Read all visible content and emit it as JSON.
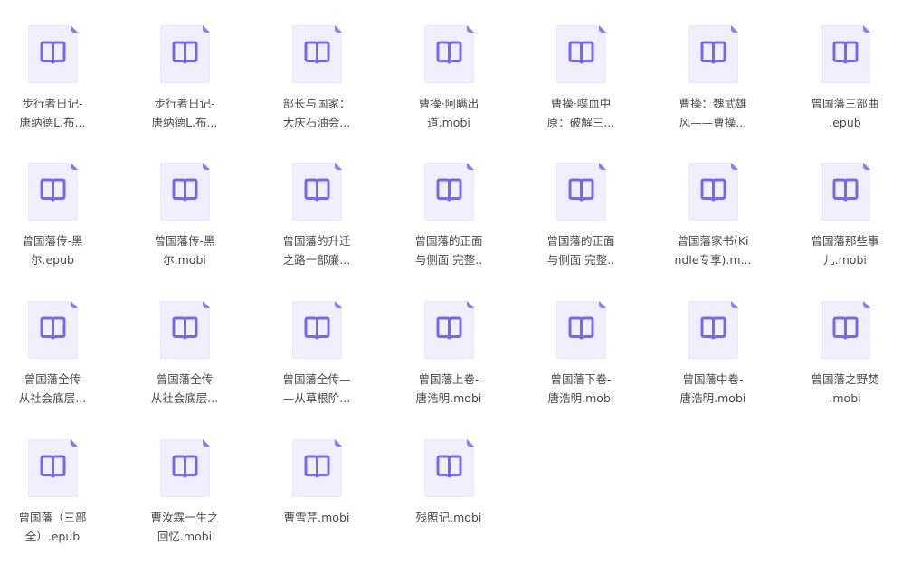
{
  "colors": {
    "icon_fill": "#f1efff",
    "icon_fold": "#8b7cf0",
    "book": "#7a67e8",
    "text": "#4a4a4a"
  },
  "files": [
    {
      "lines": [
        "步行者日记-",
        "唐纳德L.布..."
      ]
    },
    {
      "lines": [
        "步行者日记-",
        "唐纳德L.布..."
      ]
    },
    {
      "lines": [
        "部长与国家：",
        "大庆石油会..."
      ]
    },
    {
      "lines": [
        "曹操·阿瞒出",
        "道.mobi"
      ]
    },
    {
      "lines": [
        "曹操·喋血中",
        "原：破解三..."
      ]
    },
    {
      "lines": [
        "曹操：魏武雄",
        "风——曹操..."
      ]
    },
    {
      "lines": [
        "曾国藩三部曲",
        ".epub"
      ]
    },
    {
      "lines": [
        "曾国藩传-黑",
        "尔.epub"
      ]
    },
    {
      "lines": [
        "曾国藩传-黑",
        "尔.mobi"
      ]
    },
    {
      "lines": [
        "曾国藩的升迁",
        "之路一部廉..."
      ]
    },
    {
      "lines": [
        "曾国藩的正面",
        "与侧面 完整.."
      ]
    },
    {
      "lines": [
        "曾国藩的正面",
        "与侧面 完整.."
      ]
    },
    {
      "lines": [
        "曾国藩家书(Ki",
        "ndle专享).m..."
      ]
    },
    {
      "lines": [
        "曾国藩那些事",
        "儿.mobi"
      ]
    },
    {
      "lines": [
        "曾国藩全传",
        "从社会底层..."
      ]
    },
    {
      "lines": [
        "曾国藩全传",
        "从社会底层..."
      ]
    },
    {
      "lines": [
        "曾国藩全传—",
        "—从草根阶..."
      ]
    },
    {
      "lines": [
        "曾国藩上卷-",
        "唐浩明.mobi"
      ]
    },
    {
      "lines": [
        "曾国藩下卷-",
        "唐浩明.mobi"
      ]
    },
    {
      "lines": [
        "曾国藩中卷-",
        "唐浩明.mobi"
      ]
    },
    {
      "lines": [
        "曾国藩之野焚",
        ".mobi"
      ]
    },
    {
      "lines": [
        "曾国藩（三部",
        "全）.epub"
      ]
    },
    {
      "lines": [
        "曹汝霖一生之",
        "回忆.mobi"
      ]
    },
    {
      "lines": [
        "曹雪芹.mobi"
      ]
    },
    {
      "lines": [
        "残照记.mobi"
      ]
    }
  ]
}
